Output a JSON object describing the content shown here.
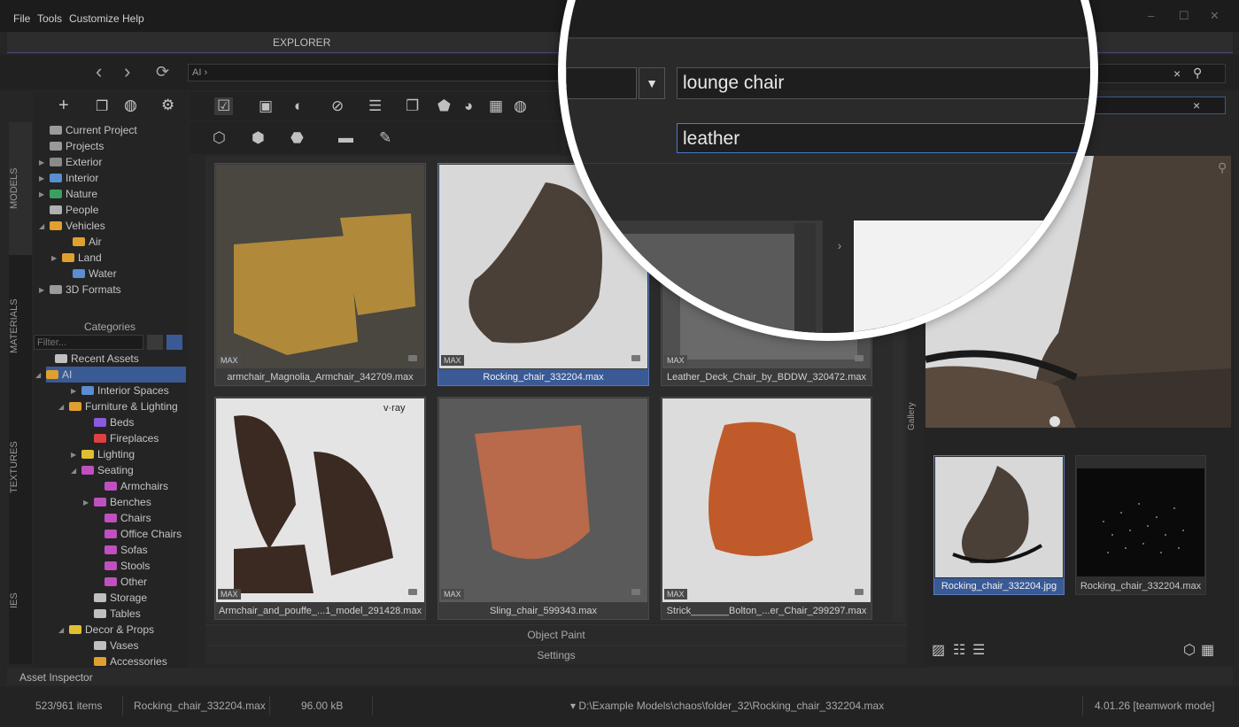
{
  "menu": [
    "File",
    "Tools",
    "Customize",
    "Help"
  ],
  "tab": {
    "explorer": "EXPLORER"
  },
  "nav": {
    "path": "AI ›",
    "back": "‹",
    "forward": "›",
    "refresh": "⟳"
  },
  "search": {
    "primary": "lounge chair",
    "secondary": "leather",
    "clear": "×"
  },
  "sidetabs": [
    "MODELS",
    "MATERIALS",
    "TEXTURES",
    "IES"
  ],
  "tree_top": [
    {
      "label": "Current Project",
      "color": "#9a9a9a"
    },
    {
      "label": "Projects",
      "color": "#9a9a9a"
    },
    {
      "label": "Exterior",
      "color": "#8a8a8a"
    },
    {
      "label": "Interior",
      "color": "#5a8ed0"
    },
    {
      "label": "Nature",
      "color": "#3aa060"
    },
    {
      "label": "People",
      "color": "#b0b0b0"
    },
    {
      "label": "Vehicles",
      "color": "#e0a030"
    },
    {
      "label": "Air",
      "color": "#e0a030"
    },
    {
      "label": "Land",
      "color": "#e0a030"
    },
    {
      "label": "Water",
      "color": "#5a8ed0"
    },
    {
      "label": "3D Formats",
      "color": "#9a9a9a"
    }
  ],
  "categories": {
    "title": "Categories",
    "filter_placeholder": "Filter..."
  },
  "tree_bottom": [
    {
      "label": "Recent Assets",
      "color": "#c0c0c0"
    },
    {
      "label": "AI",
      "color": "#e0a030"
    },
    {
      "label": "Interior Spaces",
      "color": "#5a8ed0"
    },
    {
      "label": "Furniture & Lighting",
      "color": "#e0a030"
    },
    {
      "label": "Beds",
      "color": "#8a5ae0"
    },
    {
      "label": "Fireplaces",
      "color": "#e04040"
    },
    {
      "label": "Lighting",
      "color": "#e0c030"
    },
    {
      "label": "Seating",
      "color": "#c050c0"
    },
    {
      "label": "Armchairs",
      "color": "#c050c0"
    },
    {
      "label": "Benches",
      "color": "#c050c0"
    },
    {
      "label": "Chairs",
      "color": "#c050c0"
    },
    {
      "label": "Office Chairs",
      "color": "#c050c0"
    },
    {
      "label": "Sofas",
      "color": "#c050c0"
    },
    {
      "label": "Stools",
      "color": "#c050c0"
    },
    {
      "label": "Other",
      "color": "#c050c0"
    },
    {
      "label": "Storage",
      "color": "#c0c0c0"
    },
    {
      "label": "Tables",
      "color": "#c0c0c0"
    },
    {
      "label": "Decor & Props",
      "color": "#e0c030"
    },
    {
      "label": "Vases",
      "color": "#c0c0c0"
    },
    {
      "label": "Accessories",
      "color": "#e0a030"
    }
  ],
  "assets": [
    {
      "name": "armchair_Magnolia_Armchair_342709.max",
      "badge": "MAX",
      "selected": false,
      "bg": "#4a4640",
      "obj": "#b08a3a"
    },
    {
      "name": "Rocking_chair_332204.max",
      "badge": "MAX",
      "selected": true,
      "bg": "#d8d8d8",
      "obj": "#4a4038"
    },
    {
      "name": "Leather_Deck_Chair_by_BDDW_320472.max",
      "badge": "MAX",
      "selected": false,
      "bg": "#505050",
      "obj": "#6a6a6a"
    },
    {
      "name": "Armchair_and_pouffe_...1_model_291428.max",
      "badge": "MAX",
      "selected": false,
      "bg": "#e4e4e4",
      "obj": "#3a2a22",
      "label": "v·ray"
    },
    {
      "name": "Sling_chair_599343.max",
      "badge": "MAX",
      "selected": false,
      "bg": "#5a5a5a",
      "obj": "#b86a4a"
    },
    {
      "name": "Strick_______Bolton_...er_Chair_299297.max",
      "badge": "MAX",
      "selected": false,
      "bg": "#dcdcdc",
      "obj": "#c05a2a"
    }
  ],
  "sections": {
    "object_paint": "Object Paint",
    "settings": "Settings"
  },
  "gallery": {
    "tab": "Gallery",
    "items": [
      {
        "name": "Rocking_chair_332204.jpg",
        "selected": true
      },
      {
        "name": "Rocking_chair_332204.max",
        "selected": false
      }
    ]
  },
  "inspector": {
    "title": "Asset Inspector"
  },
  "status": {
    "count": "523/961 items",
    "file": "Rocking_chair_332204.max",
    "size": "96.00 kB",
    "path": "D:\\Example Models\\chaos\\folder_32\\Rocking_chair_332204.max",
    "version": "4.01.26 [teamwork mode]"
  },
  "colors": {
    "accent": "#3a5a96",
    "bg": "#262626"
  }
}
